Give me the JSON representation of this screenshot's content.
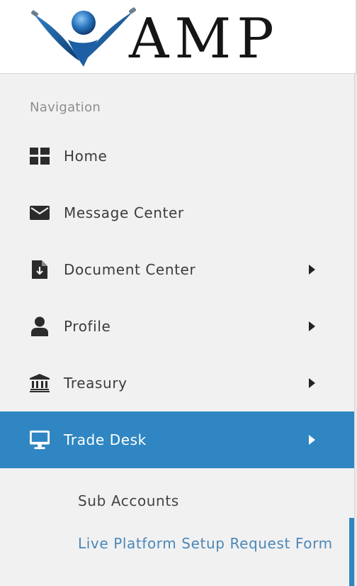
{
  "header": {
    "logo_text": "AMP",
    "logo_icon": "swoosh-figure-logo"
  },
  "navigation": {
    "heading": "Navigation",
    "items": [
      {
        "label": "Home",
        "icon": "dashboard-grid-icon",
        "has_submenu": false,
        "active": false
      },
      {
        "label": "Message Center",
        "icon": "envelope-icon",
        "has_submenu": false,
        "active": false
      },
      {
        "label": "Document Center",
        "icon": "document-download-icon",
        "has_submenu": true,
        "active": false
      },
      {
        "label": "Profile",
        "icon": "user-icon",
        "has_submenu": true,
        "active": false
      },
      {
        "label": "Treasury",
        "icon": "bank-icon",
        "has_submenu": true,
        "active": false
      },
      {
        "label": "Trade Desk",
        "icon": "monitor-icon",
        "has_submenu": true,
        "active": true
      }
    ],
    "trade_desk_submenu": [
      {
        "label": "Sub Accounts"
      },
      {
        "label": "Live Platform Setup Request Form"
      }
    ]
  },
  "colors": {
    "active_bg": "#2f86c2",
    "active_text": "#ffffff",
    "link_text": "#4a88b8",
    "item_text": "#3c3c3c",
    "heading_text": "#8e8e8e",
    "sidebar_bg": "#f2f1f1"
  }
}
